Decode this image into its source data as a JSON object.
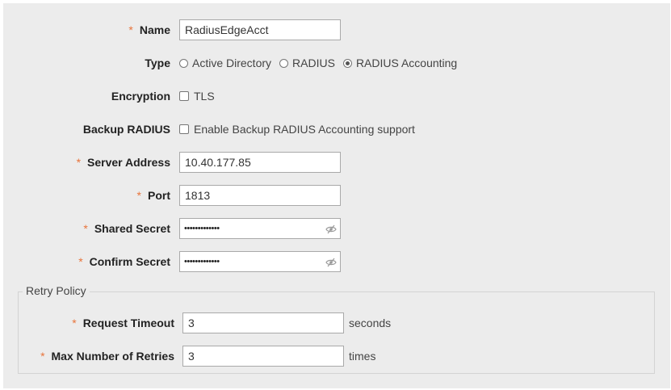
{
  "form": {
    "name": {
      "label": "Name",
      "value": "RadiusEdgeAcct"
    },
    "type": {
      "label": "Type",
      "options": [
        "Active Directory",
        "RADIUS",
        "RADIUS Accounting"
      ],
      "selected": "RADIUS Accounting"
    },
    "encryption": {
      "label": "Encryption",
      "option": "TLS",
      "checked": false
    },
    "backup_radius": {
      "label": "Backup RADIUS",
      "option": "Enable Backup RADIUS Accounting support",
      "checked": false
    },
    "server_address": {
      "label": "Server Address",
      "value": "10.40.177.85"
    },
    "port": {
      "label": "Port",
      "value": "1813"
    },
    "shared_secret": {
      "label": "Shared Secret",
      "masked": "•••••••••••••"
    },
    "confirm_secret": {
      "label": "Confirm Secret",
      "masked": "•••••••••••••"
    }
  },
  "retry_policy": {
    "legend": "Retry Policy",
    "request_timeout": {
      "label": "Request Timeout",
      "value": "3",
      "unit": "seconds"
    },
    "max_retries": {
      "label": "Max Number of Retries",
      "value": "3",
      "unit": "times"
    }
  },
  "required_marker": "*",
  "icons": {
    "password_toggle": "eye-slash-icon"
  },
  "colors": {
    "required": "#e8743b",
    "panel_bg": "#ececec"
  }
}
